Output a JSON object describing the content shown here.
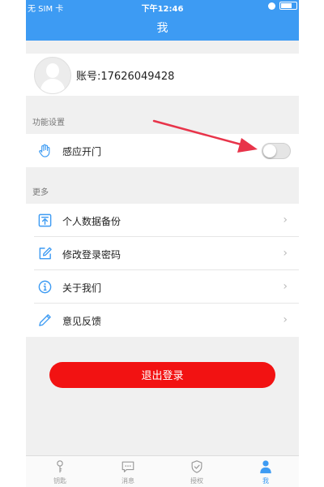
{
  "status_bar": {
    "carrier": "无 SIM 卡",
    "time": "下午12:46"
  },
  "header": {
    "title": "我"
  },
  "profile": {
    "account": "账号:17626049428"
  },
  "sections": {
    "function_settings": "功能设置",
    "more": "更多"
  },
  "settings": {
    "sensor_open": {
      "label": "感应开门",
      "icon": "hand-icon",
      "enabled": false
    }
  },
  "menu": [
    {
      "label": "个人数据备份",
      "icon": "backup-upload-icon"
    },
    {
      "label": "修改登录密码",
      "icon": "edit-icon"
    },
    {
      "label": "关于我们",
      "icon": "info-icon"
    },
    {
      "label": "意见反馈",
      "icon": "pen-icon"
    }
  ],
  "logout_label": "退出登录",
  "tabbar": [
    {
      "label": "钥匙",
      "icon": "key-icon",
      "active": false
    },
    {
      "label": "消息",
      "icon": "message-icon",
      "active": false
    },
    {
      "label": "授权",
      "icon": "shield-check-icon",
      "active": false
    },
    {
      "label": "我",
      "icon": "person-icon",
      "active": true
    }
  ],
  "colors": {
    "brand_blue": "#3d9bf3",
    "logout_red": "#f21212",
    "annotation_arrow": "#e8344a"
  }
}
